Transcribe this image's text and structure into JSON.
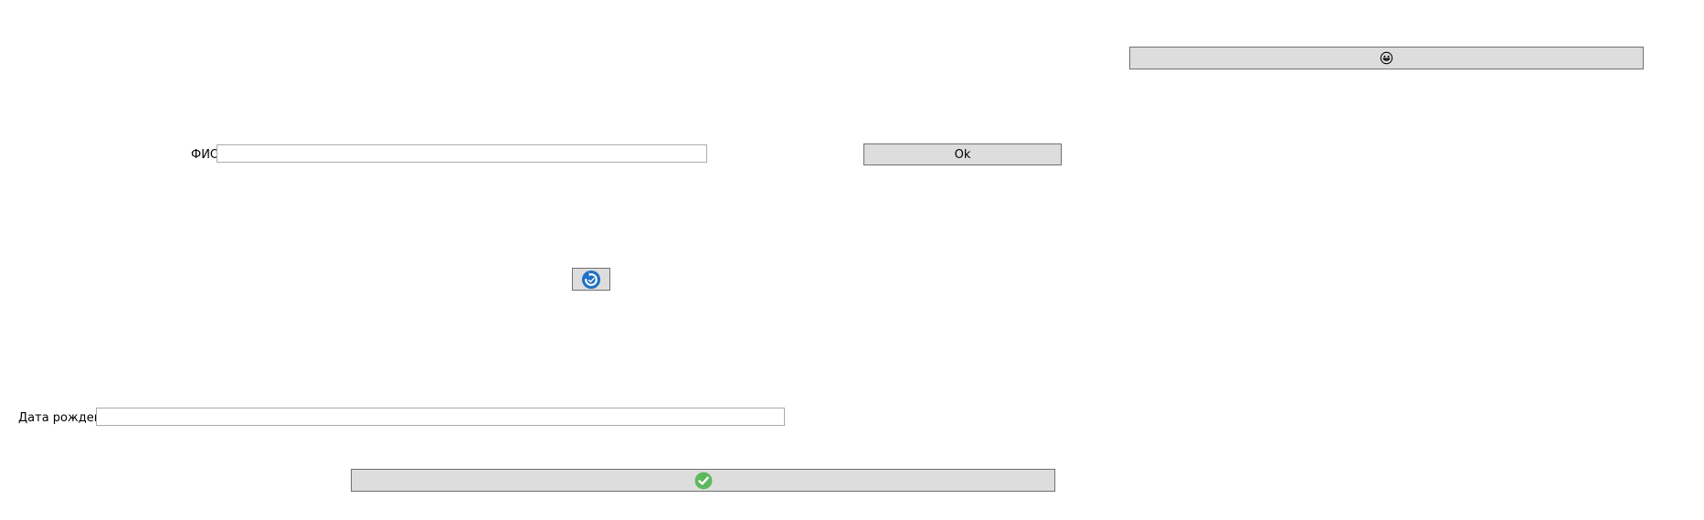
{
  "form": {
    "full_name": {
      "label": "ФИО",
      "value": ""
    },
    "birth_date": {
      "label": "Дата рождения",
      "value": ""
    },
    "ok_button": {
      "label": "Ok"
    },
    "emoji_button": {
      "icon": "grinning-face-icon"
    },
    "refresh_button": {
      "icon": "blue-circular-refresh-icon"
    },
    "confirm_button": {
      "icon": "green-check-circle-icon"
    }
  },
  "colors": {
    "button_face": "#dddddd",
    "button_border": "#707070",
    "field_border": "#ababab",
    "refresh_blue": "#1f6fc5",
    "check_green": "#5cb85c"
  }
}
